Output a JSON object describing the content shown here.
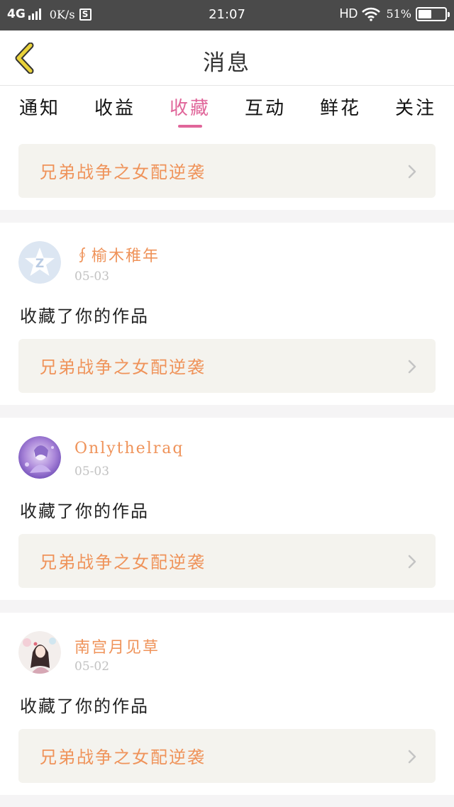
{
  "status_bar": {
    "network": "4G",
    "speed": "0K/s",
    "s_icon": "S",
    "time": "21:07",
    "hd": "HD",
    "battery_text": "51%",
    "battery_level": 0.51
  },
  "header": {
    "title": "消息",
    "back_icon": "chevron-left-icon"
  },
  "tabs": [
    {
      "label": "通知"
    },
    {
      "label": "收益"
    },
    {
      "label": "收藏",
      "active": true
    },
    {
      "label": "互动"
    },
    {
      "label": "鲜花"
    },
    {
      "label": "关注"
    }
  ],
  "top_card": {
    "work_title": "兄弟战争之女配逆袭"
  },
  "messages": [
    {
      "user": "∮榆木稚年",
      "date": "05-03",
      "text": "收藏了你的作品",
      "work_title": "兄弟战争之女配逆袭",
      "avatar": "default-star-avatar"
    },
    {
      "user": "Onlythelraq",
      "date": "05-03",
      "text": "收藏了你的作品",
      "work_title": "兄弟战争之女配逆袭",
      "avatar": "purple-anime-avatar"
    },
    {
      "user": "南宫月见草",
      "date": "05-02",
      "text": "收藏了你的作品",
      "work_title": "兄弟战争之女配逆袭",
      "avatar": "girl-illustration-avatar"
    }
  ],
  "colors": {
    "accent_pink": "#e0669a",
    "orange_text": "#ef935a",
    "back_arrow": "#e9d23a",
    "card_bg": "#f4f3ee"
  }
}
